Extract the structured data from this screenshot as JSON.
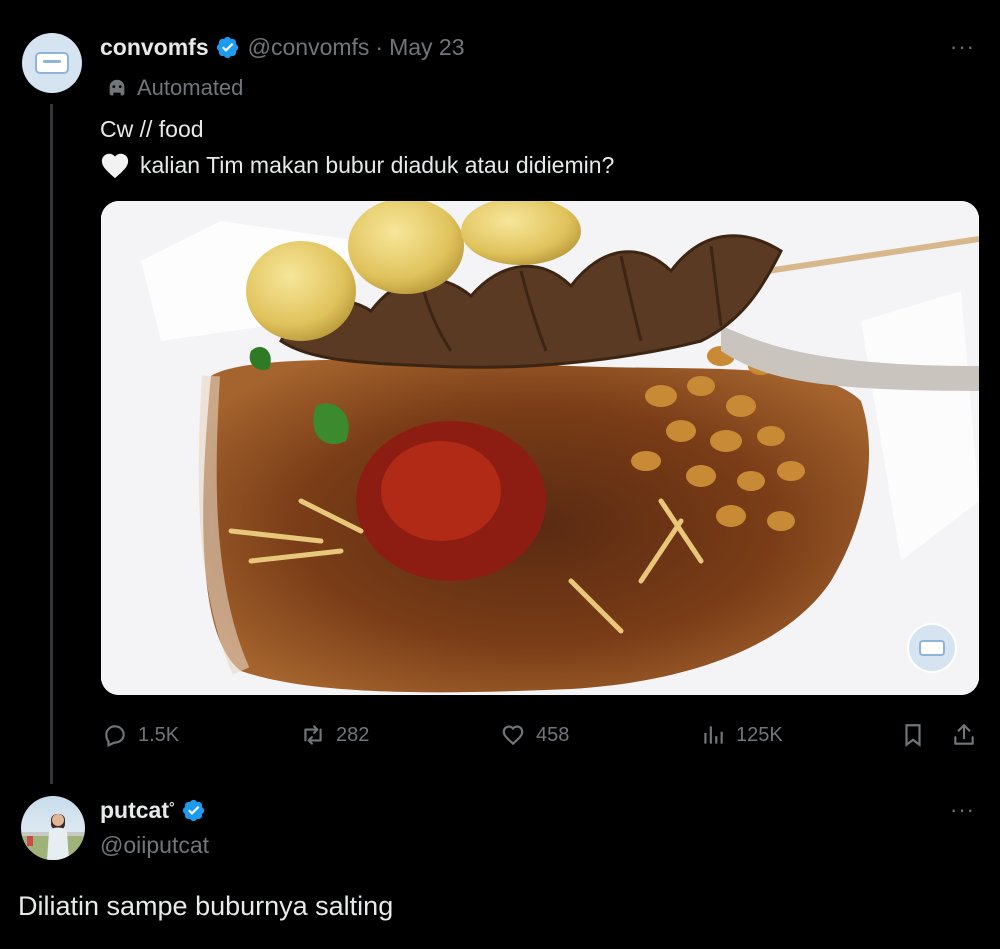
{
  "tweet": {
    "author_name": "convomfs",
    "handle": "@convomfs",
    "separator": "·",
    "date": "May 23",
    "automated_label": "Automated",
    "text_line1": "Cw // food",
    "text_line2": "kalian Tim makan bubur diaduk atau didiemin?",
    "more_label": "···",
    "media_icon": "food-photo-bubur-ayam",
    "metrics": {
      "replies": "1.5K",
      "reposts": "282",
      "likes": "458",
      "views": "125K"
    }
  },
  "reply": {
    "author_name": "putcat",
    "name_suffix": "°",
    "handle": "@oiiputcat",
    "more_label": "···",
    "text": "Diliatin sampe buburnya salting"
  },
  "colors": {
    "background": "#000000",
    "text": "#e7e9ea",
    "muted": "#71767b",
    "verified": "#1d9bf0"
  }
}
